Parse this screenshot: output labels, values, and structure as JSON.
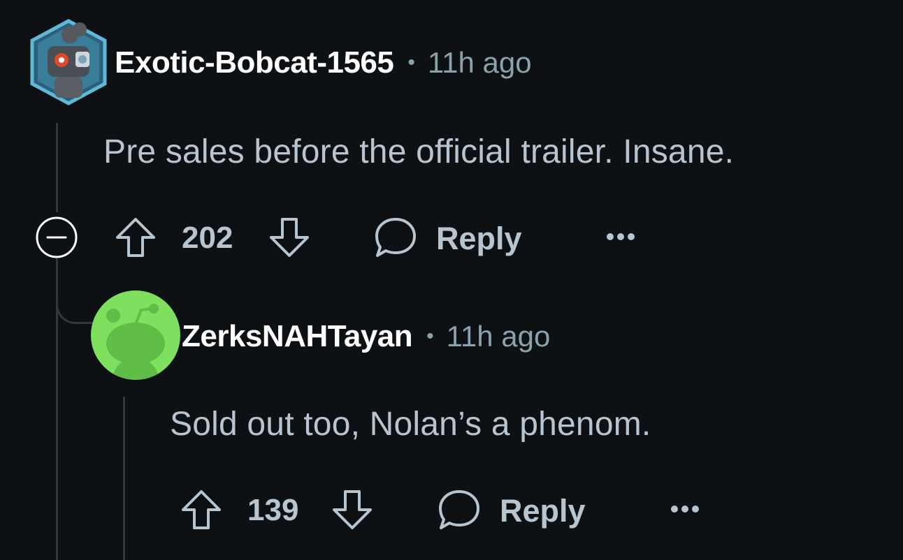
{
  "comments": [
    {
      "username": "Exotic-Bobcat-1565",
      "separator": "•",
      "time": "11h ago",
      "body": "Pre sales before the official trailer. Insane.",
      "votes": "202",
      "reply_label": "Reply"
    },
    {
      "username": "ZerksNAHTayan",
      "separator": "•",
      "time": "11h ago",
      "body": "Sold out too, Nolan’s a phenom.",
      "votes": "139",
      "reply_label": "Reply"
    }
  ],
  "icons": {
    "collapse": "collapse-minus-icon",
    "upvote": "arrow-up-outline-icon",
    "downvote": "arrow-down-outline-icon",
    "comment": "speech-bubble-icon",
    "more": "ellipsis-icon"
  },
  "colors": {
    "background": "#0e1113",
    "username": "#ffffff",
    "meta": "#8ba2ad",
    "body_text": "#b8c5d0",
    "avatar2_bg": "#7ee05e",
    "avatar1_frame": "#5fb8d6"
  }
}
